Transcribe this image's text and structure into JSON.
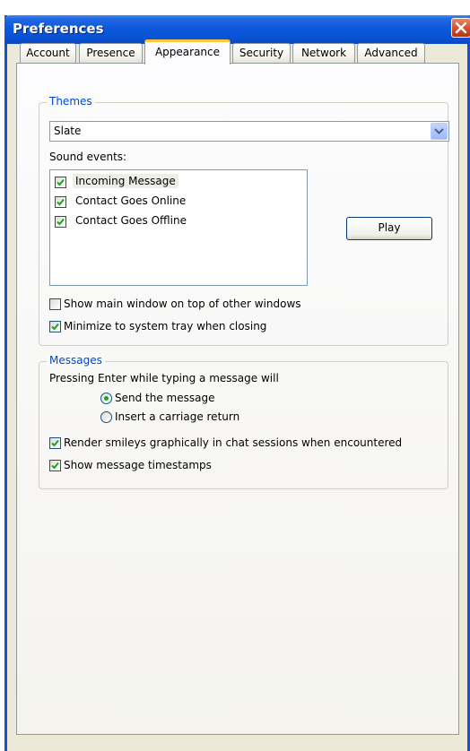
{
  "window": {
    "title": "Preferences"
  },
  "tabs": [
    {
      "label": "Account"
    },
    {
      "label": "Presence"
    },
    {
      "label": "Appearance",
      "active": true
    },
    {
      "label": "Security"
    },
    {
      "label": "Network"
    },
    {
      "label": "Advanced"
    }
  ],
  "themes": {
    "group_title": "Themes",
    "theme_select": {
      "value": "Slate"
    },
    "sound_events_label": "Sound events:",
    "sound_events": [
      {
        "label": "Incoming Message",
        "checked": true,
        "selected": true
      },
      {
        "label": "Contact Goes Online",
        "checked": true
      },
      {
        "label": "Contact Goes Offline",
        "checked": true
      }
    ],
    "play_button": "Play",
    "show_on_top": {
      "label": "Show main window on top of other windows",
      "checked": false
    },
    "minimize_tray": {
      "label": "Minimize to system tray when closing",
      "checked": true
    }
  },
  "messages": {
    "group_title": "Messages",
    "enter_label": "Pressing Enter while typing a message will",
    "enter_options": [
      {
        "label": "Send the message",
        "selected": true
      },
      {
        "label": "Insert a carriage return",
        "selected": false
      }
    ],
    "render_smileys": {
      "label": "Render smileys graphically in chat sessions when encountered",
      "checked": true
    },
    "show_timestamps": {
      "label": "Show message timestamps",
      "checked": true
    }
  },
  "colors": {
    "titlebar": "#0A52D4",
    "dialog_bg": "#ECE9D8",
    "group_title": "#0046D5",
    "active_tab_accent": "#FFC83C",
    "check": "#21A121"
  },
  "icons": {
    "close": "close-icon",
    "dropdown": "chevron-down-icon",
    "check": "checkmark-icon"
  }
}
